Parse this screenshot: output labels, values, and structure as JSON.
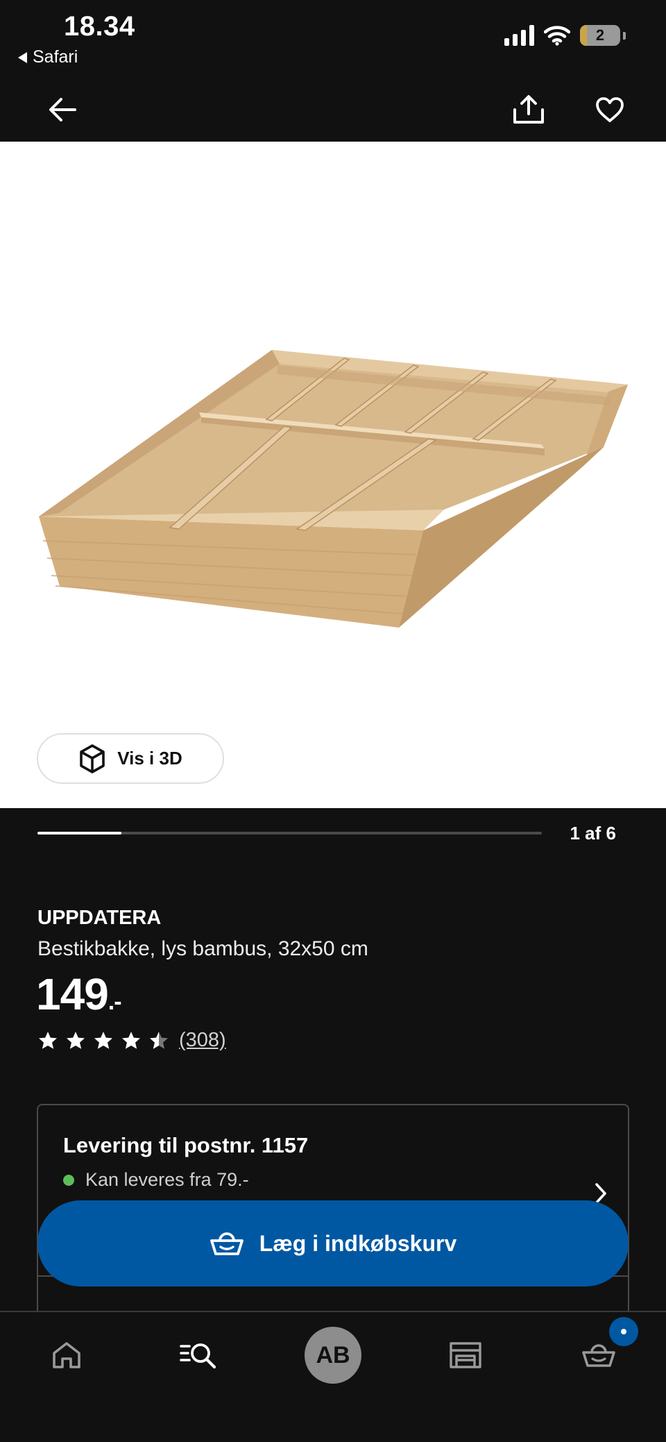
{
  "status_bar": {
    "time": "18.34",
    "back_app": "Safari",
    "battery_level": "2"
  },
  "top_nav": {
    "back_icon": "arrow-left-icon",
    "share_icon": "share-icon",
    "favorite_icon": "heart-icon"
  },
  "gallery": {
    "view_3d_label": "Vis i 3D",
    "counter": "1 af 6",
    "current_image": 1,
    "total_images": 6
  },
  "product": {
    "name": "UPPDATERA",
    "description": "Bestikbakke, lys bambus, 32x50 cm",
    "price": "149",
    "price_suffix": ".-",
    "rating": 4.5,
    "max_rating": 5,
    "review_count": "(308)"
  },
  "delivery": {
    "title": "Levering til postnr. 1157",
    "status": "Kan leveres fra 79.-",
    "status_color": "#5ebd5b"
  },
  "cart_button": {
    "label": "Læg i indkøbskurv",
    "color": "#0058a3"
  },
  "bottom_nav": {
    "items": [
      {
        "name": "home",
        "icon": "home-icon"
      },
      {
        "name": "search",
        "icon": "search-list-icon"
      },
      {
        "name": "profile",
        "initials": "AB"
      },
      {
        "name": "stores",
        "icon": "store-icon"
      },
      {
        "name": "cart",
        "icon": "basket-icon",
        "badge": true
      }
    ]
  }
}
